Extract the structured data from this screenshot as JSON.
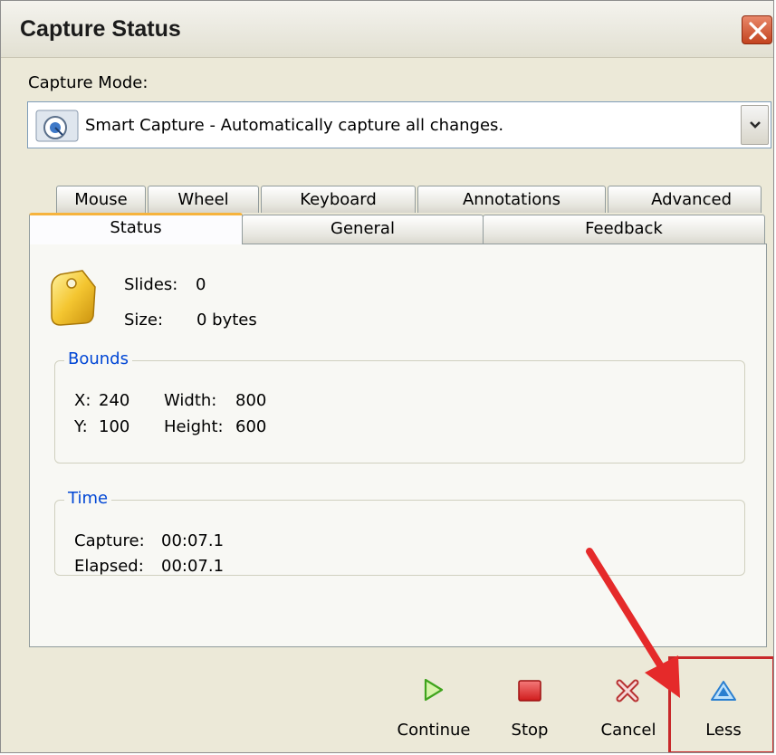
{
  "window": {
    "title": "Capture Status"
  },
  "capture_mode": {
    "label": "Capture Mode:",
    "selected": "Smart Capture - Automatically capture all changes."
  },
  "tabs": {
    "back_row": [
      "Mouse",
      "Wheel",
      "Keyboard",
      "Annotations",
      "Advanced"
    ],
    "front_row": [
      "Status",
      "General",
      "Feedback"
    ],
    "active": "Status"
  },
  "status": {
    "slides_label": "Slides:",
    "slides_value": "0",
    "size_label": "Size:",
    "size_value": "0 bytes"
  },
  "bounds": {
    "title": "Bounds",
    "x_label": "X:",
    "x_value": "240",
    "y_label": "Y:",
    "y_value": "100",
    "width_label": "Width:",
    "width_value": "800",
    "height_label": "Height:",
    "height_value": "600"
  },
  "time": {
    "title": "Time",
    "capture_label": "Capture:",
    "capture_value": "00:07.1",
    "elapsed_label": "Elapsed:",
    "elapsed_value": "00:07.1"
  },
  "buttons": {
    "continue": "Continue",
    "stop": "Stop",
    "cancel": "Cancel",
    "less": "Less"
  },
  "colors": {
    "highlight": "#c8282a",
    "group_title": "#0046d5",
    "active_tab_accent": "#f6b33d"
  },
  "icons": {
    "close": "close-icon",
    "capture_mode": "smart-capture-icon",
    "dropdown": "chevron-down-icon",
    "slides": "tag-icon",
    "continue": "play-icon",
    "stop": "stop-icon",
    "cancel": "cancel-x-icon",
    "less": "triangle-up-icon"
  }
}
